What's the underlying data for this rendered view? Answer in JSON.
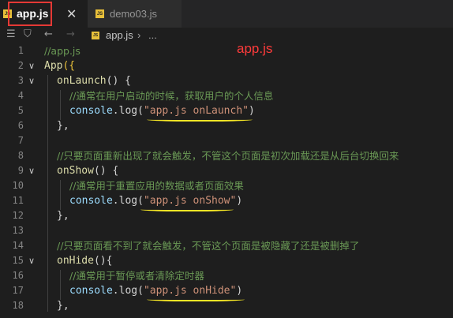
{
  "tabs": [
    {
      "label": "app.js",
      "icon": "js-file-icon",
      "active": true
    },
    {
      "label": "demo03.js",
      "icon": "js-file-icon",
      "active": false
    }
  ],
  "tab_close": "✕",
  "breadcrumb": {
    "file": "app.js",
    "separator": "›",
    "more": "..."
  },
  "line_numbers": [
    "1",
    "2",
    "3",
    "4",
    "5",
    "6",
    "7",
    "8",
    "9",
    "10",
    "11",
    "12",
    "13",
    "14",
    "15",
    "16",
    "17",
    "18"
  ],
  "code": {
    "l1": "//app.js",
    "l2_fn": "App",
    "l2_p": "({",
    "l3_fn": "onLaunch",
    "l3_p": "() {",
    "l4": "//通常在用户启动的时候，获取用户的个人信息",
    "l5_obj": "console",
    "l5_log": ".log(",
    "l5_str": "\"app.js onLaunch\"",
    "l5_end": ")",
    "l6": "},",
    "l8": "//只要页面重新出现了就会触发，不管这个页面是初次加载还是从后台切换回来",
    "l9_fn": "onShow",
    "l9_p": "() {",
    "l10": "//通常用于重置应用的数据或者页面效果",
    "l11_obj": "console",
    "l11_log": ".log(",
    "l11_str": "\"app.js onShow\"",
    "l11_end": ")",
    "l12": "},",
    "l14": "//只要页面看不到了就会触发，不管这个页面是被隐藏了还是被删掉了",
    "l15_fn": "onHide",
    "l15_p": "(){",
    "l16": "//通常用于暂停或者清除定时器",
    "l17_obj": "console",
    "l17_log": ".log(",
    "l17_str": "\"app.js onHide\"",
    "l17_end": ")",
    "l18": "},"
  },
  "annotation": "app.js",
  "colors": {
    "accent_red": "#e53935",
    "underline": "#f5e625",
    "comment": "#6a9955",
    "string": "#ce9178"
  }
}
